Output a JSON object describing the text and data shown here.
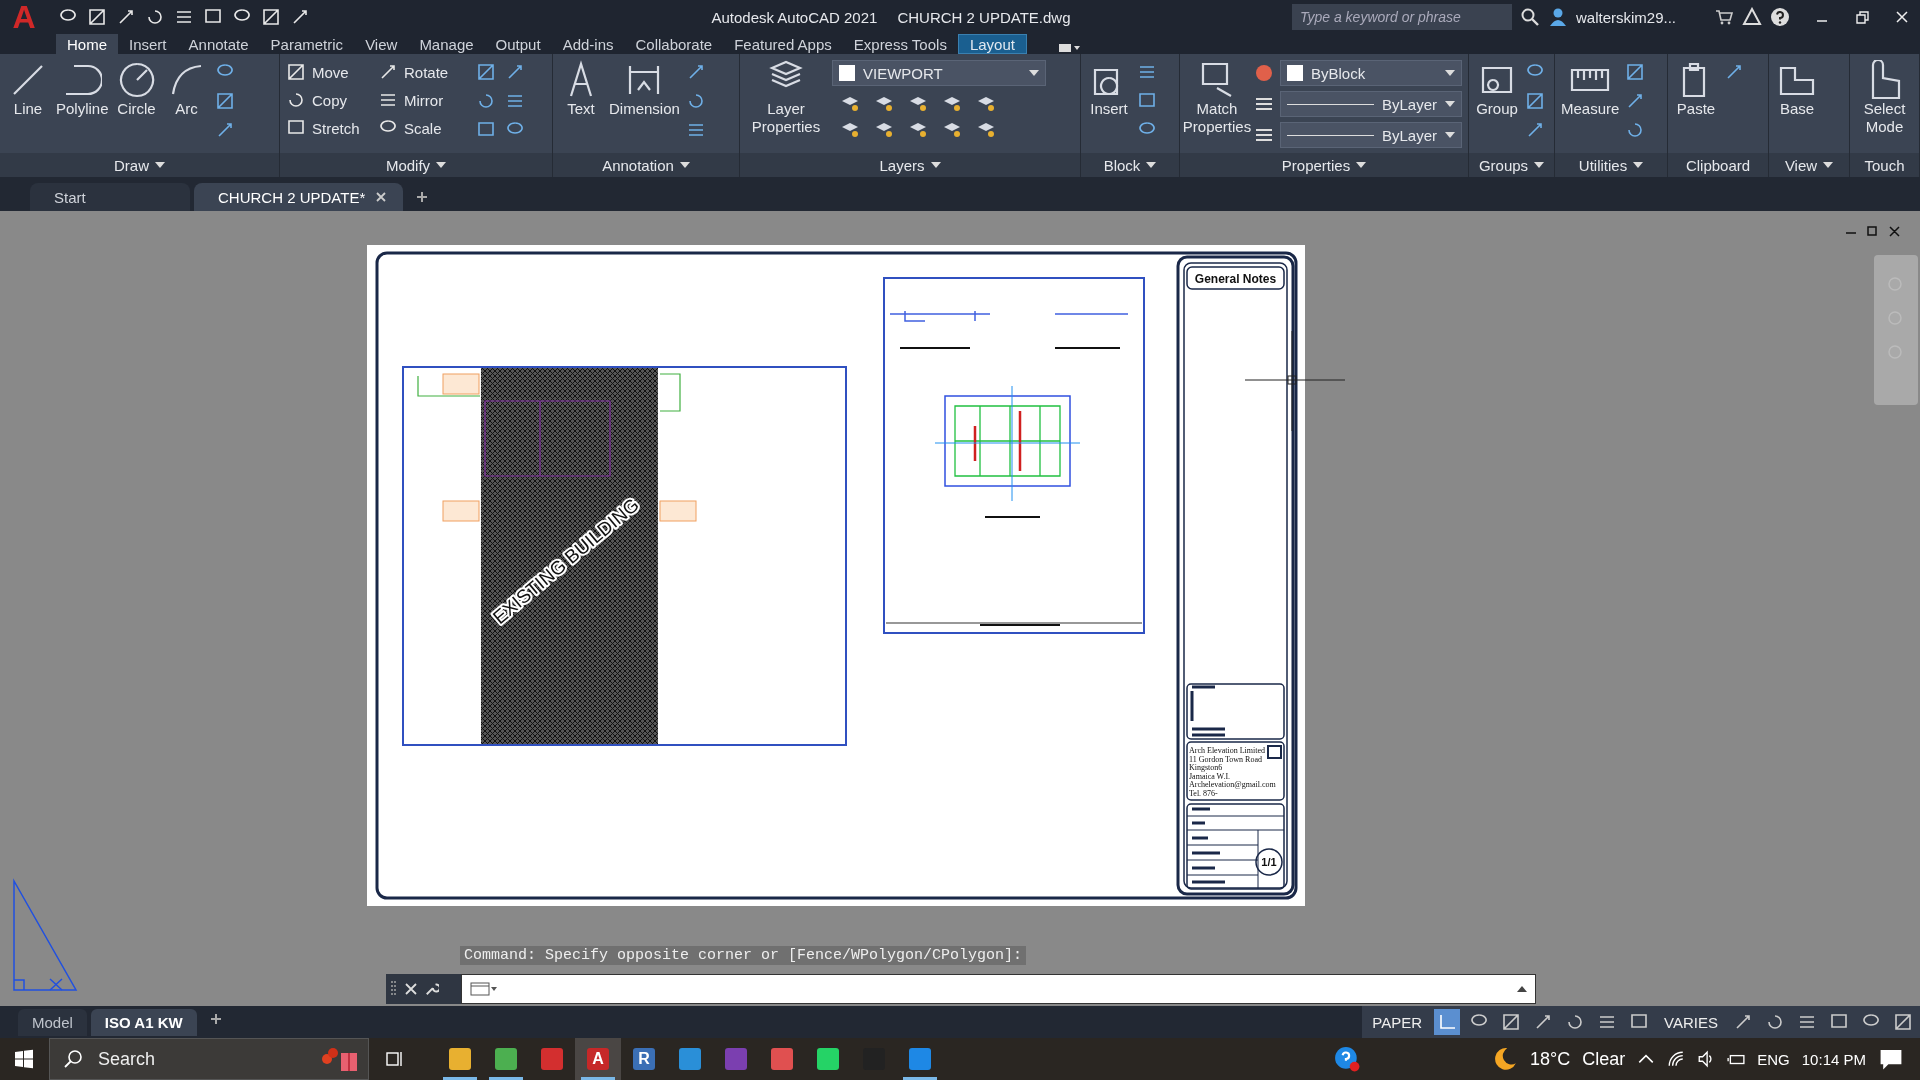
{
  "app": {
    "logo": "A",
    "title": "Autodesk AutoCAD 2021",
    "file": "CHURCH 2 UPDATE.dwg"
  },
  "search": {
    "placeholder": "Type a keyword or phrase"
  },
  "user": {
    "name": "walterskim29..."
  },
  "ribbon_tabs": [
    {
      "label": "Home",
      "selected": true,
      "kind": "standard"
    },
    {
      "label": "Insert",
      "selected": false,
      "kind": "standard"
    },
    {
      "label": "Annotate",
      "selected": false,
      "kind": "standard"
    },
    {
      "label": "Parametric",
      "selected": false,
      "kind": "standard"
    },
    {
      "label": "View",
      "selected": false,
      "kind": "standard"
    },
    {
      "label": "Manage",
      "selected": false,
      "kind": "standard"
    },
    {
      "label": "Output",
      "selected": false,
      "kind": "standard"
    },
    {
      "label": "Add-ins",
      "selected": false,
      "kind": "standard"
    },
    {
      "label": "Collaborate",
      "selected": false,
      "kind": "standard"
    },
    {
      "label": "Featured Apps",
      "selected": false,
      "kind": "standard"
    },
    {
      "label": "Express Tools",
      "selected": false,
      "kind": "standard"
    },
    {
      "label": "Layout",
      "selected": false,
      "kind": "contextual"
    }
  ],
  "panels": [
    {
      "title": "Draw",
      "menu": true,
      "large": [
        "Line",
        "Polyline",
        "Circle",
        "Arc"
      ]
    },
    {
      "title": "Modify",
      "menu": true,
      "small": [
        "Move",
        "Rotate",
        "Copy",
        "Mirror",
        "Stretch",
        "Scale"
      ]
    },
    {
      "title": "Annotation",
      "menu": true,
      "large": [
        "Text",
        "Dimension"
      ]
    },
    {
      "title": "Layers",
      "menu": true,
      "large": [
        "Layer Properties"
      ],
      "dropdowns": [
        "VIEWPORT"
      ]
    },
    {
      "title": "Block",
      "menu": true,
      "large": [
        "Insert"
      ]
    },
    {
      "title": "Properties",
      "menu": true,
      "large": [
        "Match Properties"
      ],
      "dropdowns": [
        "ByBlock",
        "ByLayer",
        "ByLayer"
      ]
    },
    {
      "title": "Groups",
      "menu": true,
      "large": [
        "Group"
      ]
    },
    {
      "title": "Utilities",
      "menu": true,
      "large": [
        "Measure"
      ]
    },
    {
      "title": "Clipboard",
      "menu": false,
      "large": [
        "Paste"
      ]
    },
    {
      "title": "View",
      "menu": true,
      "large": [
        "Base"
      ]
    },
    {
      "title": "Touch",
      "menu": false,
      "large": [
        "Select Mode"
      ]
    }
  ],
  "doc_tabs": [
    {
      "label": "Start",
      "selected": false
    },
    {
      "label": "CHURCH 2 UPDATE*",
      "selected": true
    }
  ],
  "drawing": {
    "viewport_label": "EXISTING BUILDING",
    "notes_title": "General Notes",
    "company_lines": [
      "Arch Elevation Limited",
      "11 Gordon Town Road",
      "Kingston6",
      "Jamaica W.I.",
      "Archelevation@gmail.com",
      "Tel. 876-"
    ],
    "sheet": "1/1"
  },
  "command": {
    "history": "Command: Specify opposite corner or [Fence/WPolygon/CPolygon]:"
  },
  "layout_tabs": [
    {
      "label": "Model",
      "selected": false
    },
    {
      "label": "ISO A1 KW",
      "selected": true
    }
  ],
  "status": {
    "space": "PAPER",
    "scale": "VARIES"
  },
  "taskbar": {
    "search_placeholder": "Search",
    "apps": [
      {
        "running": true,
        "selected": false
      },
      {
        "running": true,
        "selected": false
      },
      {
        "running": false,
        "selected": false
      },
      {
        "running": true,
        "selected": true,
        "glyph": "A"
      },
      {
        "running": false,
        "selected": false,
        "glyph": "R"
      },
      {
        "running": false,
        "selected": false
      },
      {
        "running": false,
        "selected": false
      },
      {
        "running": false,
        "selected": false
      },
      {
        "running": false,
        "selected": false
      },
      {
        "running": false,
        "selected": false
      },
      {
        "running": true,
        "selected": false
      }
    ],
    "temperature": "18°C",
    "weather": "Clear",
    "language": "ENG",
    "time": "10:14 PM"
  }
}
